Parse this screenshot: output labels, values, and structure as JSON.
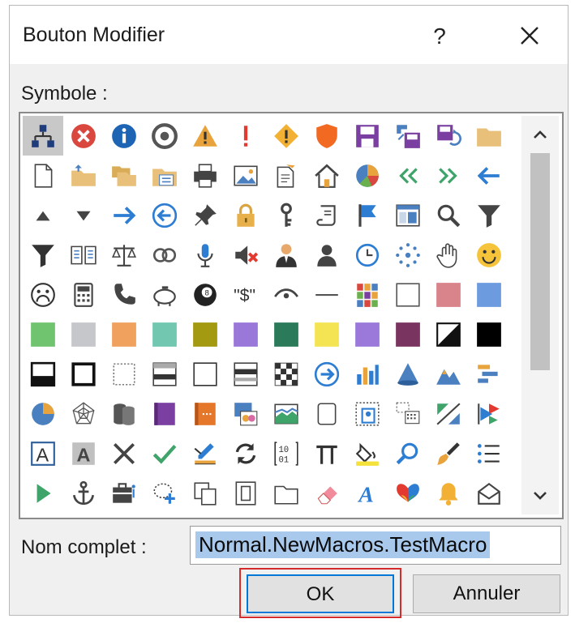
{
  "dialog": {
    "title": "Bouton Modifier",
    "help_label": "?",
    "close_icon": "close-icon"
  },
  "symbol_label": "Symbole :",
  "full_name_label": "Nom complet :",
  "full_name_value": "Normal.NewMacros.TestMacro",
  "buttons": {
    "ok": "OK",
    "cancel": "Annuler"
  },
  "colors": {
    "ok_focus": "#0078d7",
    "highlight_outline": "#d42b2b",
    "selection": "#a8c8ec"
  },
  "symbols": [
    [
      "org-chart",
      "error",
      "info",
      "target",
      "warning",
      "exclamation",
      "warning-diamond",
      "shield",
      "save",
      "save-floppy-alt",
      "save-sync",
      "folder"
    ],
    [
      "document",
      "folder-up",
      "folders",
      "folder-doc",
      "printer",
      "picture",
      "document-edit",
      "home",
      "pie",
      "double-left",
      "double-right",
      "arrow-left"
    ],
    [
      "triangle-up",
      "triangle-down",
      "arrow-right",
      "circle-left",
      "pin",
      "lock",
      "key",
      "scroll",
      "flag",
      "table-window",
      "search",
      "funnel"
    ],
    [
      "funnel-dark",
      "book",
      "scales",
      "rings",
      "microphone",
      "mute",
      "person-suit",
      "person",
      "clock",
      "burst",
      "hand",
      "smiley"
    ],
    [
      "sad-face",
      "calculator",
      "phone",
      "piggy-bank",
      "eight-ball",
      "dollar-quote",
      "eye",
      "line",
      "tiles",
      "square-outline",
      "swatch-pink",
      "swatch-blue"
    ],
    [
      "swatch-green",
      "swatch-gray",
      "swatch-orange",
      "swatch-teal",
      "swatch-olive",
      "swatch-purple",
      "swatch-darkgreen",
      "swatch-yellow",
      "swatch-violet",
      "swatch-maroon",
      "half-black",
      "black"
    ],
    [
      "bar-bottom",
      "square-thick",
      "square-dotted",
      "rows",
      "square-thin",
      "rows-alt",
      "checker",
      "circle-right",
      "bar-chart",
      "cone",
      "mountains",
      "gantt"
    ],
    [
      "pie-chart",
      "spider",
      "cylinders",
      "book-purple",
      "book-orange",
      "picture-collage",
      "landscape",
      "rounded-box",
      "frame-id",
      "gallery",
      "vector",
      "flowchart"
    ],
    [
      "letter-a-box",
      "letter-a-gray",
      "cross",
      "check",
      "edit-ruler",
      "refresh",
      "binary",
      "pi",
      "paint-bucket",
      "magnifier",
      "brush",
      "list"
    ],
    [
      "play",
      "anchor",
      "briefcase",
      "lasso-add",
      "copy",
      "page-frame",
      "page-blank",
      "eraser",
      "letter-a-script",
      "butterfly",
      "bell",
      "envelope"
    ]
  ]
}
